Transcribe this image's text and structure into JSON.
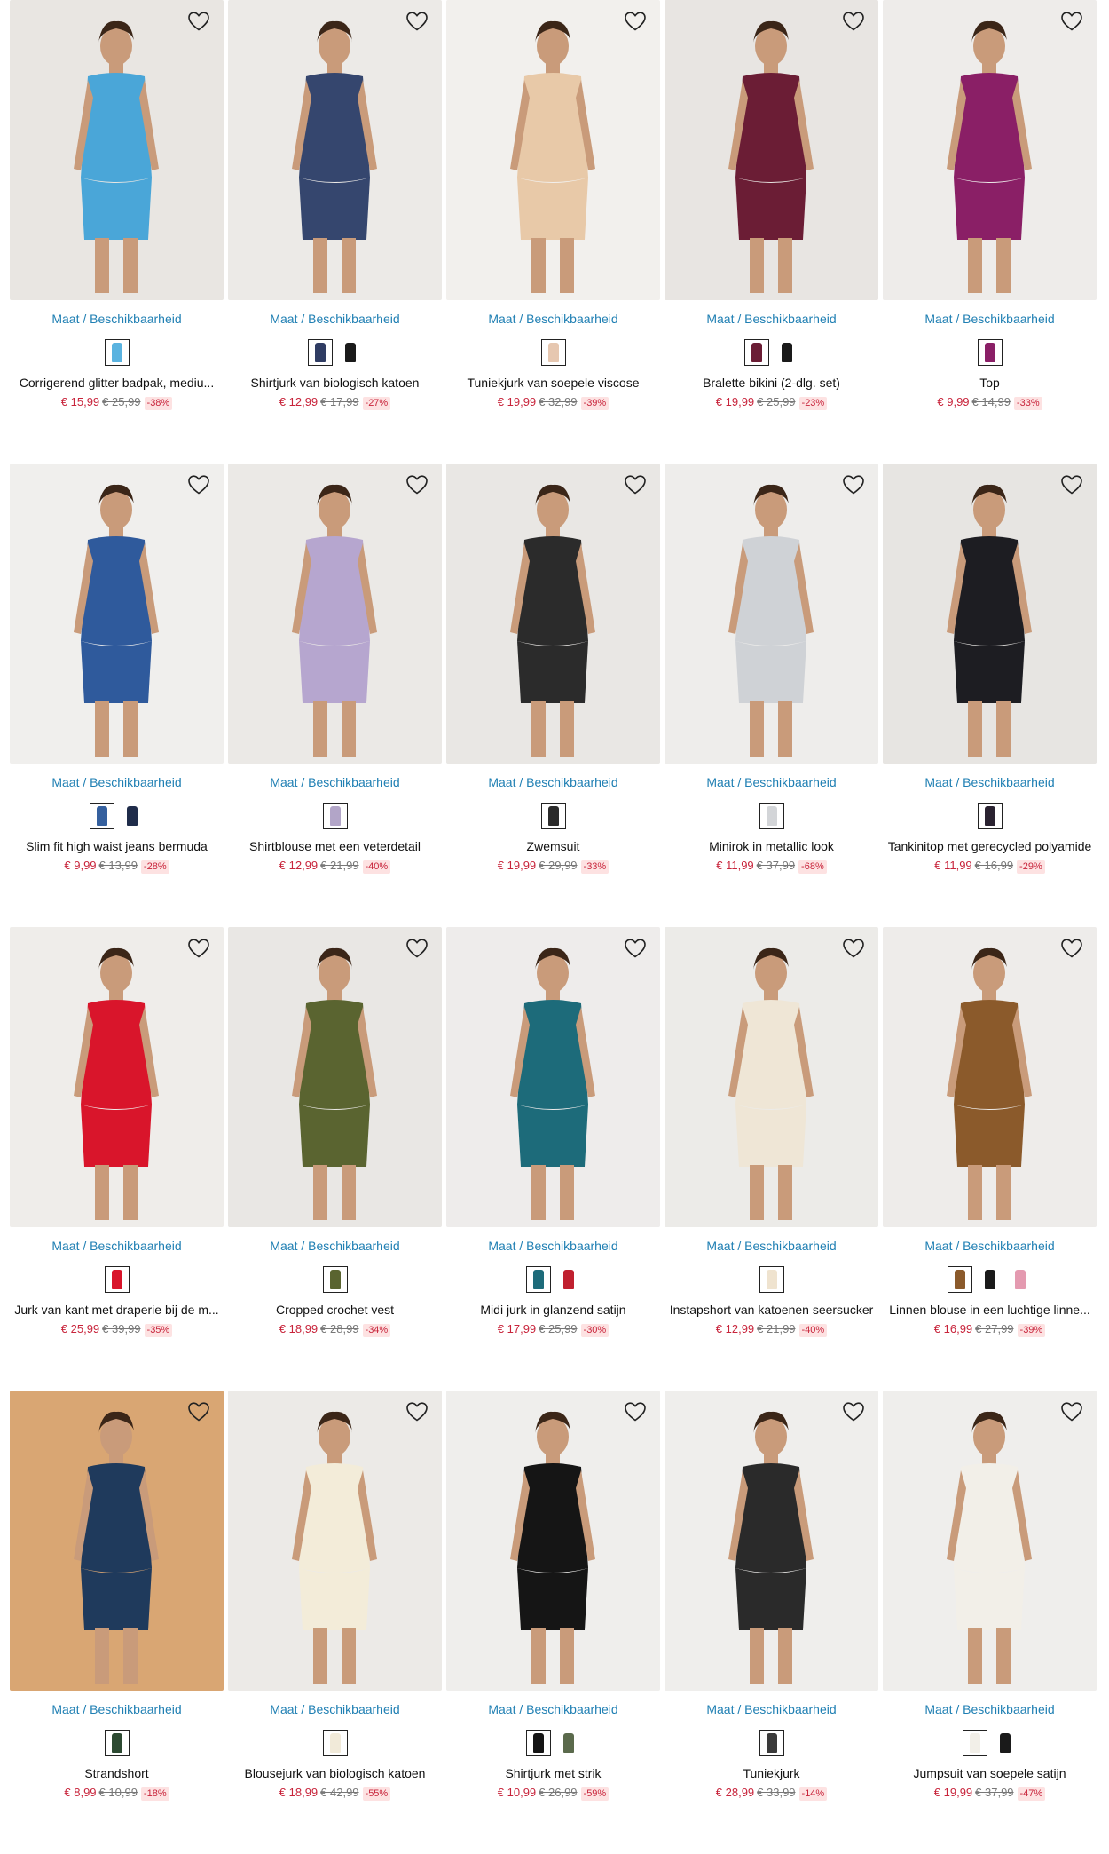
{
  "sizes_label": "Maat / Beschikbaarheid",
  "icons": {
    "favorite": "heart-outline-icon"
  },
  "colors": {
    "link": "#1f7fb3",
    "sale_price": "#c8243b",
    "old_price": "#777777",
    "discount_bg": "#fde2e2"
  },
  "products": [
    {
      "name": "Corrigerend glitter badpak, mediu...",
      "price": "€ 15,99",
      "old_price": "€ 25,99",
      "discount": "-38%",
      "bg": "#e9e6e2",
      "garment": "#4aa6d8",
      "swatches": [
        "#5ab3e0"
      ]
    },
    {
      "name": "Shirtjurk van biologisch katoen",
      "price": "€ 12,99",
      "old_price": "€ 17,99",
      "discount": "-27%",
      "bg": "#eceae7",
      "garment": "#35466e",
      "swatches": [
        "#2f3c63",
        "#1a1a1a"
      ]
    },
    {
      "name": "Tuniekjurk van soepele viscose",
      "price": "€ 19,99",
      "old_price": "€ 32,99",
      "discount": "-39%",
      "bg": "#f2f0ed",
      "garment": "#e8c9a8",
      "swatches": [
        "#e6c7b0"
      ]
    },
    {
      "name": "Bralette bikini (2-dlg. set)",
      "price": "€ 19,99",
      "old_price": "€ 25,99",
      "discount": "-23%",
      "bg": "#e8e5e2",
      "garment": "#6b1d35",
      "swatches": [
        "#6b1d35",
        "#1a1a1a"
      ]
    },
    {
      "name": "Top",
      "price": "€ 9,99",
      "old_price": "€ 14,99",
      "discount": "-33%",
      "bg": "#eeecea",
      "garment": "#8a1f66",
      "swatches": [
        "#8a1f66"
      ]
    },
    {
      "name": "Slim fit high waist jeans bermuda",
      "price": "€ 9,99",
      "old_price": "€ 13,99",
      "discount": "-28%",
      "bg": "#f0efed",
      "garment": "#2f5a9c",
      "swatches": [
        "#35609e",
        "#1f2c4a"
      ]
    },
    {
      "name": "Shirtblouse met een veterdetail",
      "price": "€ 12,99",
      "old_price": "€ 21,99",
      "discount": "-40%",
      "bg": "#ebe9e6",
      "garment": "#b6a6cf",
      "swatches": [
        "#b2a5c8"
      ]
    },
    {
      "name": "Zwemsuit",
      "price": "€ 19,99",
      "old_price": "€ 29,99",
      "discount": "-33%",
      "bg": "#e9e7e4",
      "garment": "#2b2b2b",
      "swatches": [
        "#2b2b2b"
      ]
    },
    {
      "name": "Minirok in metallic look",
      "price": "€ 11,99",
      "old_price": "€ 37,99",
      "discount": "-68%",
      "bg": "#eeedeb",
      "garment": "#cfd2d6",
      "swatches": [
        "#d3d5d8"
      ]
    },
    {
      "name": "Tankinitop met gerecycled polyamide",
      "price": "€ 11,99",
      "old_price": "€ 16,99",
      "discount": "-29%",
      "bg": "#e7e5e2",
      "garment": "#1d1d22",
      "swatches": [
        "#2a2230"
      ]
    },
    {
      "name": "Jurk van kant met draperie bij de m...",
      "price": "€ 25,99",
      "old_price": "€ 39,99",
      "discount": "-35%",
      "bg": "#efedea",
      "garment": "#d9152b",
      "swatches": [
        "#d9152b"
      ]
    },
    {
      "name": "Cropped crochet vest",
      "price": "€ 18,99",
      "old_price": "€ 28,99",
      "discount": "-34%",
      "bg": "#e9e7e4",
      "garment": "#5a6430",
      "swatches": [
        "#5a6430"
      ]
    },
    {
      "name": "Midi jurk in glanzend satijn",
      "price": "€ 17,99",
      "old_price": "€ 25,99",
      "discount": "-30%",
      "bg": "#eeeceb",
      "garment": "#1d6b7a",
      "swatches": [
        "#1d6b7a",
        "#c0202f"
      ]
    },
    {
      "name": "Instapshort van katoenen seersucker",
      "price": "€ 12,99",
      "old_price": "€ 21,99",
      "discount": "-40%",
      "bg": "#ecebe8",
      "garment": "#efe6d6",
      "swatches": [
        "#efe3cf"
      ]
    },
    {
      "name": "Linnen blouse in een luchtige linne...",
      "price": "€ 16,99",
      "old_price": "€ 27,99",
      "discount": "-39%",
      "bg": "#eeecea",
      "garment": "#8b5a2b",
      "swatches": [
        "#8b5a2b",
        "#1a1a1a",
        "#e49ab0"
      ]
    },
    {
      "name": "Strandshort",
      "price": "€ 8,99",
      "old_price": "€ 10,99",
      "discount": "-18%",
      "bg": "#d9a673",
      "garment": "#1f3a5c",
      "swatches": [
        "#2d4a32"
      ]
    },
    {
      "name": "Blousejurk van biologisch katoen",
      "price": "€ 18,99",
      "old_price": "€ 42,99",
      "discount": "-55%",
      "bg": "#eceae7",
      "garment": "#f3ecd9",
      "swatches": [
        "#f1ead9"
      ]
    },
    {
      "name": "Shirtjurk met strik",
      "price": "€ 10,99",
      "old_price": "€ 26,99",
      "discount": "-59%",
      "bg": "#efeeec",
      "garment": "#151515",
      "swatches": [
        "#151515",
        "#5b6a4c"
      ]
    },
    {
      "name": "Tuniekjurk",
      "price": "€ 28,99",
      "old_price": "€ 33,99",
      "discount": "-14%",
      "bg": "#efeeec",
      "garment": "#2a2a2a",
      "swatches": [
        "#3a3a3a"
      ]
    },
    {
      "name": "Jumpsuit van soepele satijn",
      "price": "€ 19,99",
      "old_price": "€ 37,99",
      "discount": "-47%",
      "bg": "#efeeec",
      "garment": "#f2efe8",
      "swatches": [
        "#f2efe8",
        "#1a1a1a"
      ]
    }
  ]
}
